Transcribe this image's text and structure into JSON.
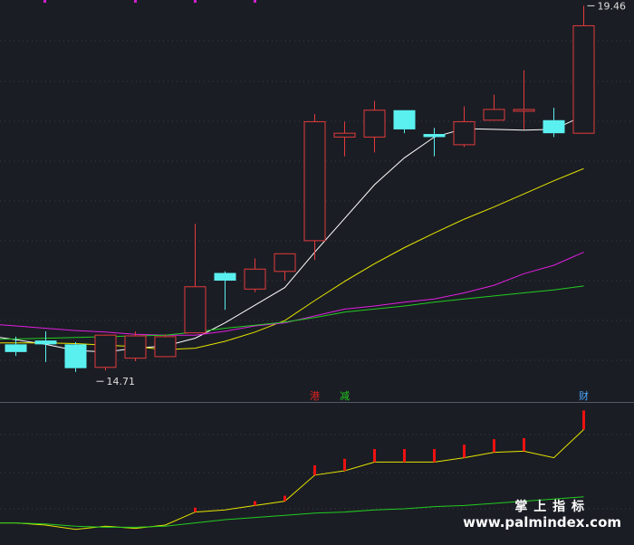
{
  "chart_data": [
    {
      "type": "candlestick",
      "panel": "price",
      "ylim": [
        14.5,
        19.5
      ],
      "candles": [
        {
          "o": 15.05,
          "h": 15.15,
          "l": 14.9,
          "c": 14.95
        },
        {
          "o": 15.1,
          "h": 15.22,
          "l": 14.82,
          "c": 15.05
        },
        {
          "o": 15.05,
          "h": 15.08,
          "l": 14.69,
          "c": 14.74
        },
        {
          "o": 14.75,
          "h": 15.18,
          "l": 14.71,
          "c": 15.17
        },
        {
          "o": 14.87,
          "h": 15.22,
          "l": 14.83,
          "c": 15.16
        },
        {
          "o": 14.89,
          "h": 15.18,
          "l": 14.89,
          "c": 15.15
        },
        {
          "o": 15.2,
          "h": 16.62,
          "l": 15.2,
          "c": 15.8
        },
        {
          "o": 15.98,
          "h": 16.0,
          "l": 15.5,
          "c": 15.88
        },
        {
          "o": 15.77,
          "h": 16.17,
          "l": 15.73,
          "c": 16.03
        },
        {
          "o": 16.0,
          "h": 16.22,
          "l": 15.88,
          "c": 16.23
        },
        {
          "o": 16.4,
          "h": 18.05,
          "l": 16.15,
          "c": 17.95
        },
        {
          "o": 17.75,
          "h": 17.95,
          "l": 17.5,
          "c": 17.8
        },
        {
          "o": 17.75,
          "h": 18.22,
          "l": 17.55,
          "c": 18.1
        },
        {
          "o": 18.1,
          "h": 18.1,
          "l": 17.8,
          "c": 17.85
        },
        {
          "o": 17.79,
          "h": 17.87,
          "l": 17.5,
          "c": 17.75
        },
        {
          "o": 17.65,
          "h": 18.15,
          "l": 17.62,
          "c": 17.95
        },
        {
          "o": 17.97,
          "h": 18.3,
          "l": 17.97,
          "c": 18.11
        },
        {
          "o": 18.1,
          "h": 18.62,
          "l": 17.85,
          "c": 18.11
        },
        {
          "o": 17.97,
          "h": 18.13,
          "l": 17.75,
          "c": 17.8
        },
        {
          "o": 17.8,
          "h": 19.46,
          "l": 17.8,
          "c": 19.2
        }
      ],
      "moving_averages": [
        {
          "color": "#ffffff",
          "values": [
            15.11,
            15.05,
            14.97,
            14.95,
            15.0,
            15.03,
            15.13,
            15.33,
            15.56,
            15.79,
            16.25,
            16.69,
            17.13,
            17.48,
            17.75,
            17.86,
            17.85,
            17.84,
            17.85,
            18.03
          ]
        },
        {
          "color": "#e6e600",
          "values": [
            15.07,
            15.07,
            15.06,
            15.04,
            15.02,
            14.98,
            15.0,
            15.09,
            15.21,
            15.36,
            15.62,
            15.87,
            16.1,
            16.31,
            16.5,
            16.68,
            16.84,
            17.01,
            17.18,
            17.34
          ]
        },
        {
          "color": "#e020e0",
          "values": [
            15.29,
            15.26,
            15.23,
            15.21,
            15.18,
            15.17,
            15.17,
            15.22,
            15.29,
            15.33,
            15.42,
            15.51,
            15.55,
            15.6,
            15.64,
            15.72,
            15.82,
            15.97,
            16.08,
            16.25
          ]
        },
        {
          "color": "#22cc22",
          "values": [
            15.12,
            15.13,
            15.14,
            15.15,
            15.16,
            15.17,
            15.21,
            15.26,
            15.3,
            15.34,
            15.4,
            15.47,
            15.51,
            15.55,
            15.6,
            15.64,
            15.68,
            15.72,
            15.76,
            15.81
          ]
        }
      ],
      "annotations": [
        {
          "text": "14.71",
          "candle": 3,
          "value": 14.71
        },
        {
          "text": "19.46",
          "candle": 19,
          "value": 19.46
        }
      ],
      "markers": [
        {
          "text": "港",
          "candle": 10,
          "color": "#dd2222"
        },
        {
          "text": "减",
          "candle": 11,
          "color": "#22cc22"
        },
        {
          "text": "财",
          "candle": 19,
          "color": "#4aa8ff"
        }
      ]
    },
    {
      "type": "indicator",
      "panel": "lower",
      "ylim": [
        0,
        100
      ],
      "bars": [
        0,
        0,
        0,
        0,
        0,
        0,
        8,
        0,
        8,
        10,
        18,
        22,
        24,
        24,
        24,
        24,
        24,
        24,
        0,
        35
      ],
      "series": [
        {
          "color": "#e6e600",
          "values": [
            12,
            10,
            6,
            9,
            7,
            10,
            22,
            24,
            28,
            32,
            56,
            60,
            68,
            68,
            68,
            72,
            77,
            78,
            72,
            98
          ]
        },
        {
          "color": "#22cc22",
          "values": [
            12,
            11,
            9,
            8,
            8,
            9,
            12,
            15,
            17,
            19,
            21,
            22,
            24,
            25,
            27,
            28,
            30,
            32,
            34,
            36
          ]
        }
      ]
    }
  ],
  "watermark": {
    "cn": "掌 上 指 标",
    "url": "www.palmindex.com"
  }
}
